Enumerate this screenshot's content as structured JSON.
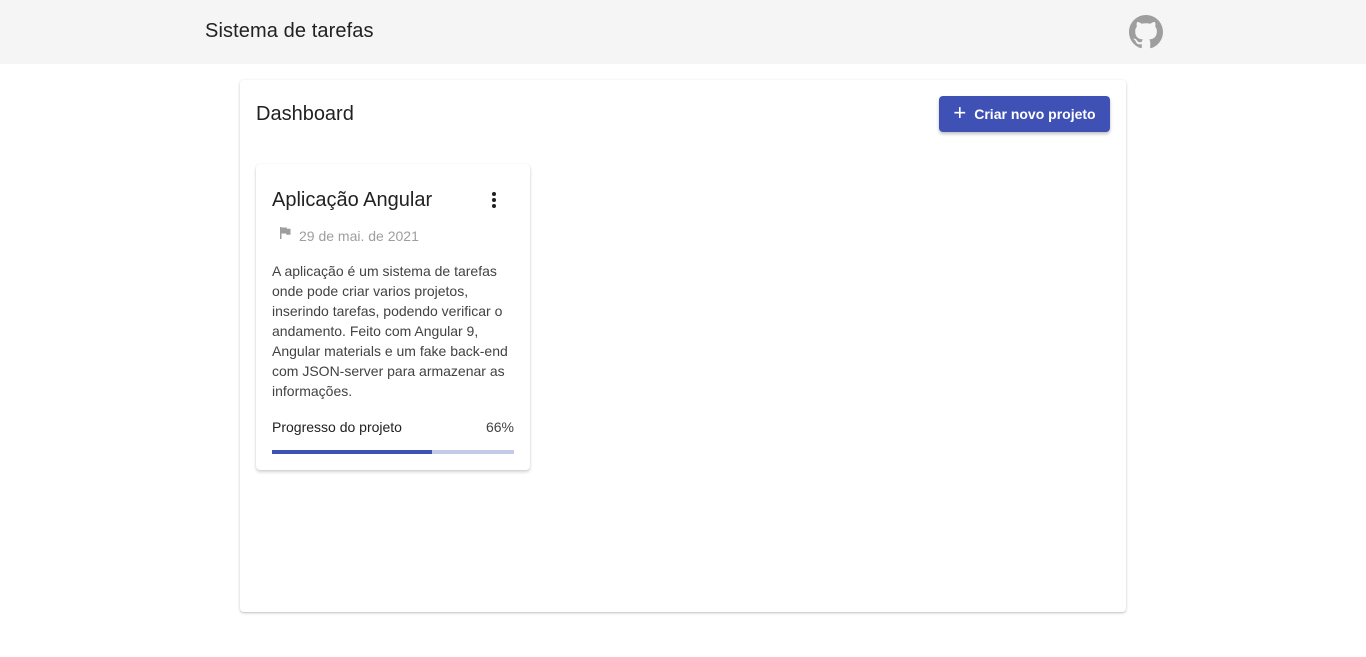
{
  "header": {
    "app_title": "Sistema de tarefas",
    "github_icon": "github-icon"
  },
  "dashboard": {
    "title": "Dashboard",
    "create_button": {
      "icon": "plus-icon",
      "label": "Criar novo projeto"
    }
  },
  "projects": [
    {
      "title": "Aplicação Angular",
      "menu_icon": "more-vert-icon",
      "flag_icon": "flag-icon",
      "date": "29 de mai. de 2021",
      "description": "A aplicação é um sistema de tarefas onde pode criar varios projetos, inserindo tarefas, podendo verificar o andamento. Feito com Angular 9, Angular materials e um fake back-end com JSON-server para armazenar as informações.",
      "progress_label": "Progresso do projeto",
      "progress_text": "66%",
      "progress_value": 0.66
    }
  ],
  "colors": {
    "primary": "#3f51b5",
    "progress_track": "#c5cae9",
    "topbar_bg": "#f5f5f5"
  }
}
